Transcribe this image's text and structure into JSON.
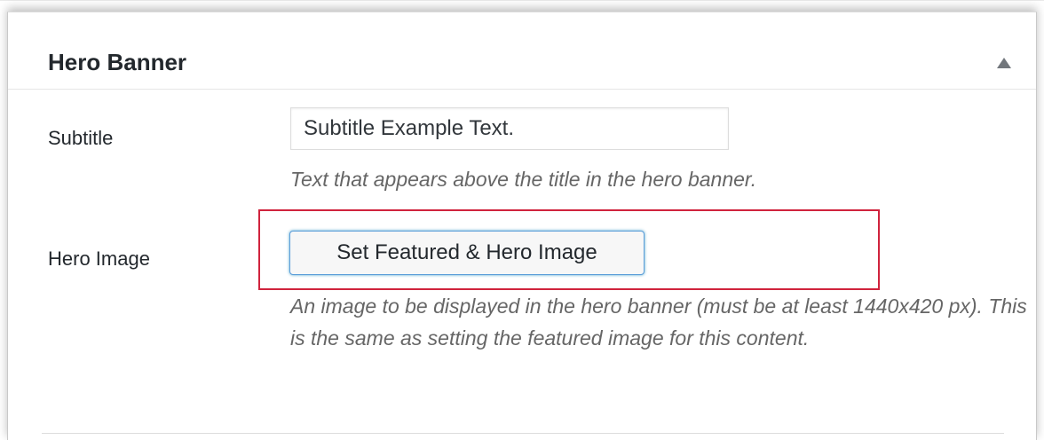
{
  "metabox": {
    "title": "Hero Banner",
    "toggle_icon": "triangle-up-icon"
  },
  "fields": {
    "subtitle": {
      "label": "Subtitle",
      "value": "Subtitle Example Text.",
      "description": "Text that appears above the title in the hero banner."
    },
    "hero_image": {
      "label": "Hero Image",
      "button_label": "Set Featured & Hero Image",
      "description": "An image to be displayed in the hero banner (must be at least 1440x420 px). This is the same as setting the featured image for this content."
    }
  },
  "colors": {
    "highlight": "#d0233d",
    "focus_border": "#5b9dd9",
    "description_text": "#666666"
  }
}
